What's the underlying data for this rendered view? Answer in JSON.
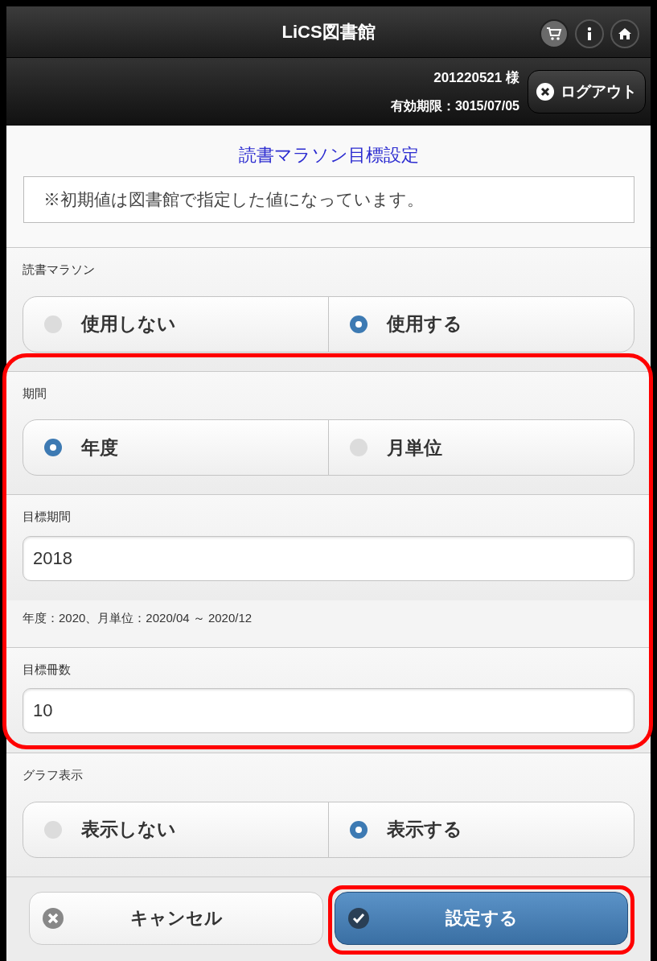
{
  "header": {
    "title": "LiCS図書館"
  },
  "user_bar": {
    "user": "201220521 様",
    "expiry": "有効期限：3015/07/05",
    "logout_button": "ログアウト"
  },
  "page_title": "読書マラソン目標設定",
  "note": "※初期値は図書館で指定した値になっています。",
  "groups": [
    {
      "highlighted": false,
      "sections": [
        {
          "kind": "radio",
          "label": "読書マラソン",
          "options": [
            {
              "label": "使用しない",
              "selected": false
            },
            {
              "label": "使用する",
              "selected": true
            }
          ]
        }
      ]
    },
    {
      "highlighted": true,
      "sections": [
        {
          "kind": "radio",
          "label": "期間",
          "options": [
            {
              "label": "年度",
              "selected": true
            },
            {
              "label": "月単位",
              "selected": false
            }
          ]
        },
        {
          "kind": "input",
          "label": "目標期間",
          "value": "2018",
          "help": "年度：2020、月単位：2020/04 ～ 2020/12"
        },
        {
          "kind": "input",
          "label": "目標冊数",
          "value": "10"
        }
      ]
    },
    {
      "highlighted": false,
      "sections": [
        {
          "kind": "radio",
          "label": "グラフ表示",
          "options": [
            {
              "label": "表示しない",
              "selected": false
            },
            {
              "label": "表示する",
              "selected": true
            }
          ]
        }
      ]
    }
  ],
  "buttons": [
    {
      "kind": "cancel",
      "label": "キャンセル",
      "highlighted": false
    },
    {
      "kind": "submit",
      "label": "設定する",
      "highlighted": true
    }
  ]
}
